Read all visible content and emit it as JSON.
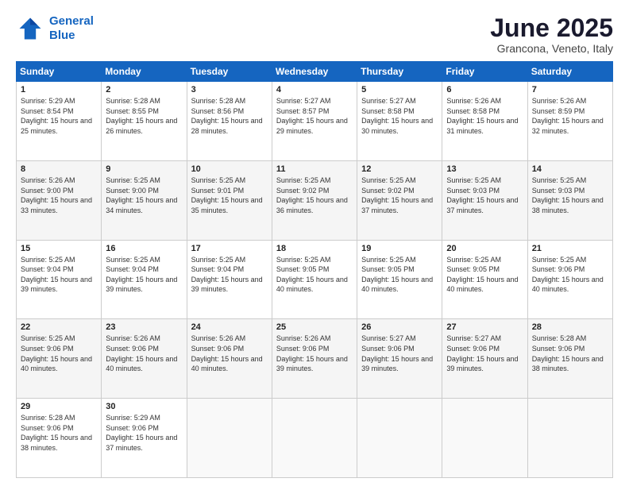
{
  "logo": {
    "line1": "General",
    "line2": "Blue"
  },
  "title": "June 2025",
  "location": "Grancona, Veneto, Italy",
  "days_header": [
    "Sunday",
    "Monday",
    "Tuesday",
    "Wednesday",
    "Thursday",
    "Friday",
    "Saturday"
  ],
  "weeks": [
    [
      {
        "day": "1",
        "rise": "Sunrise: 5:29 AM",
        "set": "Sunset: 8:54 PM",
        "daylight": "Daylight: 15 hours and 25 minutes."
      },
      {
        "day": "2",
        "rise": "Sunrise: 5:28 AM",
        "set": "Sunset: 8:55 PM",
        "daylight": "Daylight: 15 hours and 26 minutes."
      },
      {
        "day": "3",
        "rise": "Sunrise: 5:28 AM",
        "set": "Sunset: 8:56 PM",
        "daylight": "Daylight: 15 hours and 28 minutes."
      },
      {
        "day": "4",
        "rise": "Sunrise: 5:27 AM",
        "set": "Sunset: 8:57 PM",
        "daylight": "Daylight: 15 hours and 29 minutes."
      },
      {
        "day": "5",
        "rise": "Sunrise: 5:27 AM",
        "set": "Sunset: 8:58 PM",
        "daylight": "Daylight: 15 hours and 30 minutes."
      },
      {
        "day": "6",
        "rise": "Sunrise: 5:26 AM",
        "set": "Sunset: 8:58 PM",
        "daylight": "Daylight: 15 hours and 31 minutes."
      },
      {
        "day": "7",
        "rise": "Sunrise: 5:26 AM",
        "set": "Sunset: 8:59 PM",
        "daylight": "Daylight: 15 hours and 32 minutes."
      }
    ],
    [
      {
        "day": "8",
        "rise": "Sunrise: 5:26 AM",
        "set": "Sunset: 9:00 PM",
        "daylight": "Daylight: 15 hours and 33 minutes."
      },
      {
        "day": "9",
        "rise": "Sunrise: 5:25 AM",
        "set": "Sunset: 9:00 PM",
        "daylight": "Daylight: 15 hours and 34 minutes."
      },
      {
        "day": "10",
        "rise": "Sunrise: 5:25 AM",
        "set": "Sunset: 9:01 PM",
        "daylight": "Daylight: 15 hours and 35 minutes."
      },
      {
        "day": "11",
        "rise": "Sunrise: 5:25 AM",
        "set": "Sunset: 9:02 PM",
        "daylight": "Daylight: 15 hours and 36 minutes."
      },
      {
        "day": "12",
        "rise": "Sunrise: 5:25 AM",
        "set": "Sunset: 9:02 PM",
        "daylight": "Daylight: 15 hours and 37 minutes."
      },
      {
        "day": "13",
        "rise": "Sunrise: 5:25 AM",
        "set": "Sunset: 9:03 PM",
        "daylight": "Daylight: 15 hours and 37 minutes."
      },
      {
        "day": "14",
        "rise": "Sunrise: 5:25 AM",
        "set": "Sunset: 9:03 PM",
        "daylight": "Daylight: 15 hours and 38 minutes."
      }
    ],
    [
      {
        "day": "15",
        "rise": "Sunrise: 5:25 AM",
        "set": "Sunset: 9:04 PM",
        "daylight": "Daylight: 15 hours and 39 minutes."
      },
      {
        "day": "16",
        "rise": "Sunrise: 5:25 AM",
        "set": "Sunset: 9:04 PM",
        "daylight": "Daylight: 15 hours and 39 minutes."
      },
      {
        "day": "17",
        "rise": "Sunrise: 5:25 AM",
        "set": "Sunset: 9:04 PM",
        "daylight": "Daylight: 15 hours and 39 minutes."
      },
      {
        "day": "18",
        "rise": "Sunrise: 5:25 AM",
        "set": "Sunset: 9:05 PM",
        "daylight": "Daylight: 15 hours and 40 minutes."
      },
      {
        "day": "19",
        "rise": "Sunrise: 5:25 AM",
        "set": "Sunset: 9:05 PM",
        "daylight": "Daylight: 15 hours and 40 minutes."
      },
      {
        "day": "20",
        "rise": "Sunrise: 5:25 AM",
        "set": "Sunset: 9:05 PM",
        "daylight": "Daylight: 15 hours and 40 minutes."
      },
      {
        "day": "21",
        "rise": "Sunrise: 5:25 AM",
        "set": "Sunset: 9:06 PM",
        "daylight": "Daylight: 15 hours and 40 minutes."
      }
    ],
    [
      {
        "day": "22",
        "rise": "Sunrise: 5:25 AM",
        "set": "Sunset: 9:06 PM",
        "daylight": "Daylight: 15 hours and 40 minutes."
      },
      {
        "day": "23",
        "rise": "Sunrise: 5:26 AM",
        "set": "Sunset: 9:06 PM",
        "daylight": "Daylight: 15 hours and 40 minutes."
      },
      {
        "day": "24",
        "rise": "Sunrise: 5:26 AM",
        "set": "Sunset: 9:06 PM",
        "daylight": "Daylight: 15 hours and 40 minutes."
      },
      {
        "day": "25",
        "rise": "Sunrise: 5:26 AM",
        "set": "Sunset: 9:06 PM",
        "daylight": "Daylight: 15 hours and 39 minutes."
      },
      {
        "day": "26",
        "rise": "Sunrise: 5:27 AM",
        "set": "Sunset: 9:06 PM",
        "daylight": "Daylight: 15 hours and 39 minutes."
      },
      {
        "day": "27",
        "rise": "Sunrise: 5:27 AM",
        "set": "Sunset: 9:06 PM",
        "daylight": "Daylight: 15 hours and 39 minutes."
      },
      {
        "day": "28",
        "rise": "Sunrise: 5:28 AM",
        "set": "Sunset: 9:06 PM",
        "daylight": "Daylight: 15 hours and 38 minutes."
      }
    ],
    [
      {
        "day": "29",
        "rise": "Sunrise: 5:28 AM",
        "set": "Sunset: 9:06 PM",
        "daylight": "Daylight: 15 hours and 38 minutes."
      },
      {
        "day": "30",
        "rise": "Sunrise: 5:29 AM",
        "set": "Sunset: 9:06 PM",
        "daylight": "Daylight: 15 hours and 37 minutes."
      },
      {
        "day": "",
        "rise": "",
        "set": "",
        "daylight": ""
      },
      {
        "day": "",
        "rise": "",
        "set": "",
        "daylight": ""
      },
      {
        "day": "",
        "rise": "",
        "set": "",
        "daylight": ""
      },
      {
        "day": "",
        "rise": "",
        "set": "",
        "daylight": ""
      },
      {
        "day": "",
        "rise": "",
        "set": "",
        "daylight": ""
      }
    ]
  ]
}
